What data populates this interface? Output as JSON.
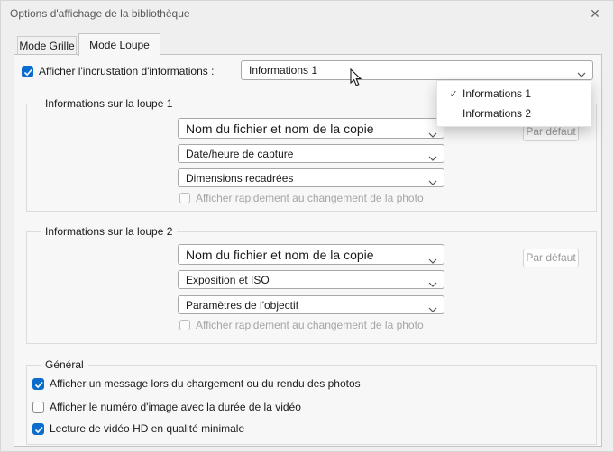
{
  "window": {
    "title": "Options d'affichage de la bibliothèque"
  },
  "icons": {
    "close": "✕",
    "menu_check": "✓"
  },
  "tabs": {
    "grid": "Mode Grille",
    "loupe": "Mode Loupe"
  },
  "overlay": {
    "label": "Afficher l'incrustation d'informations :",
    "checked": true,
    "value": "Informations 1"
  },
  "menu": {
    "items": [
      {
        "label": "Informations 1",
        "check": "✓"
      },
      {
        "label": "Informations 2",
        "check": ""
      }
    ]
  },
  "loupe1": {
    "legend": "Informations sur la loupe 1",
    "selects": [
      "Nom du fichier et nom de la copie",
      "Date/heure de capture",
      "Dimensions recadrées"
    ],
    "quick_label": "Afficher rapidement au changement de la photo",
    "quick_checked": false,
    "default_button": "Par défaut"
  },
  "loupe2": {
    "legend": "Informations sur la loupe 2",
    "selects": [
      "Nom du fichier et nom de la copie",
      "Exposition et ISO",
      "Paramètres de l'objectif"
    ],
    "quick_label": "Afficher rapidement au changement de la photo",
    "quick_checked": false,
    "default_button": "Par défaut"
  },
  "general": {
    "legend": "Général",
    "checkboxes": [
      {
        "label": "Afficher un message lors du chargement ou du rendu des photos",
        "checked": true
      },
      {
        "label": "Afficher le numéro d'image avec la durée de la vidéo",
        "checked": false
      },
      {
        "label": "Lecture de vidéo HD en qualité minimale",
        "checked": true
      }
    ]
  },
  "colors": {
    "accent": "#0b6dcb"
  }
}
